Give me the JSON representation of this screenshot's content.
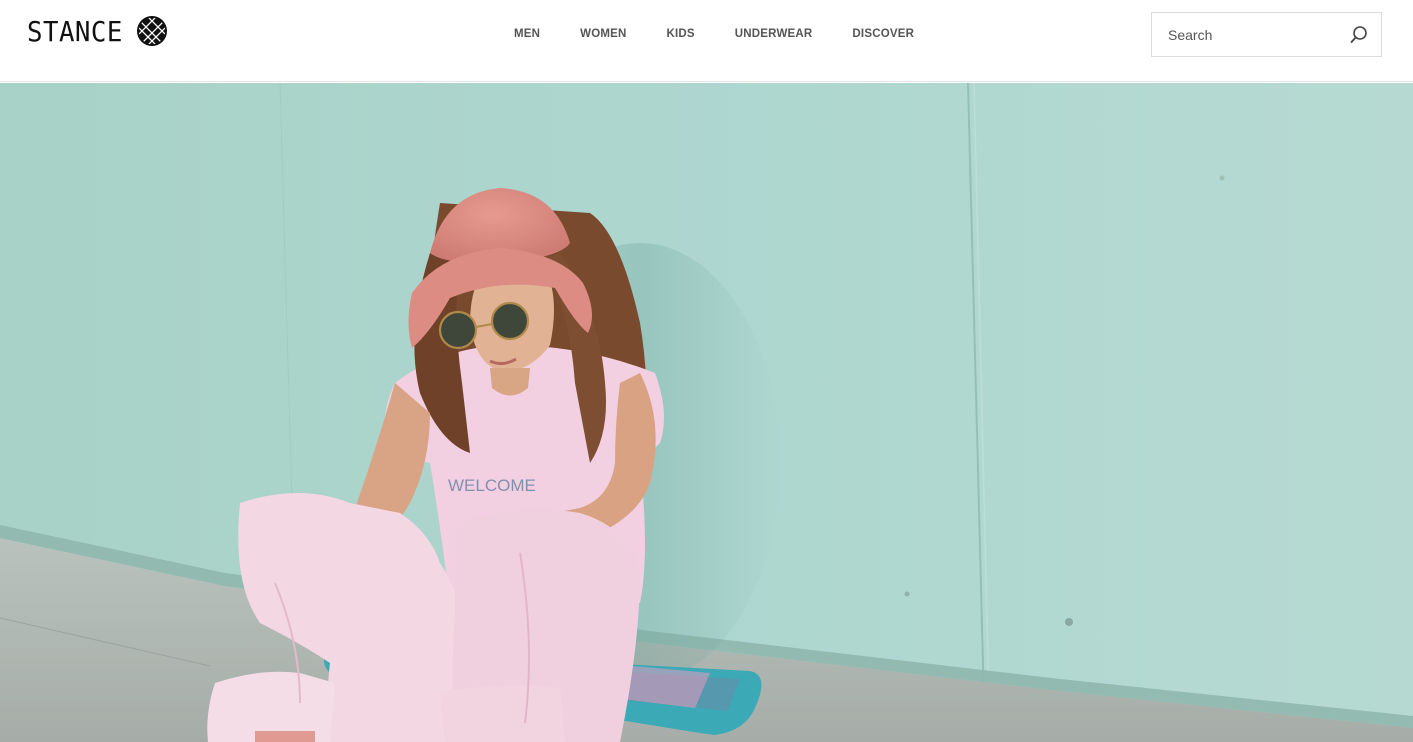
{
  "brand": {
    "name": "STANCE",
    "logo_icon": "stance-crosshatch-icon"
  },
  "nav": {
    "items": [
      {
        "label": "MEN"
      },
      {
        "label": "WOMEN"
      },
      {
        "label": "KIDS"
      },
      {
        "label": "UNDERWEAR"
      },
      {
        "label": "DISCOVER"
      }
    ]
  },
  "search": {
    "placeholder": "Search",
    "value": "",
    "icon": "search-icon"
  },
  "hero": {
    "image_alt": "",
    "shirt_text": "WELCOME"
  },
  "colors": {
    "wall": "#a9d1c9",
    "hat": "#dd8a82",
    "outfit": "#f3cfe0",
    "text_nav": "#555555"
  }
}
